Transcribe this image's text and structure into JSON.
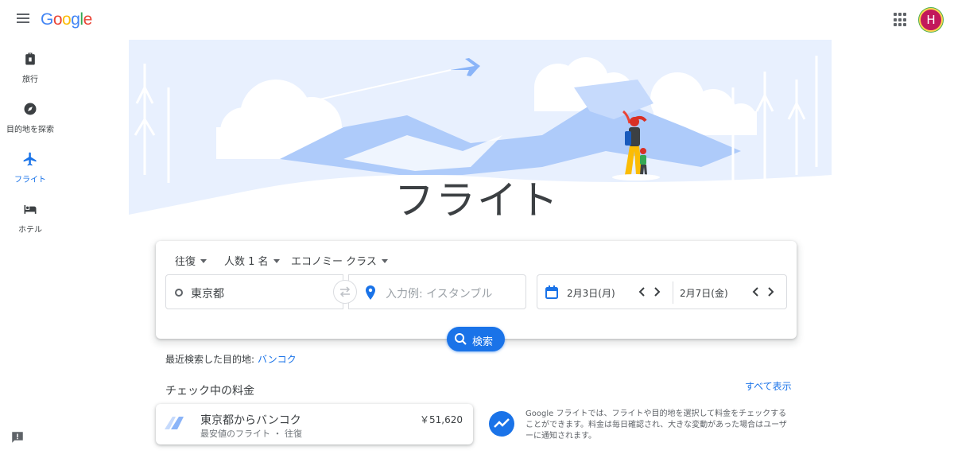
{
  "header": {
    "logo_letters": [
      {
        "ch": "G",
        "color": "#4285f4"
      },
      {
        "ch": "o",
        "color": "#ea4335"
      },
      {
        "ch": "o",
        "color": "#fbbc05"
      },
      {
        "ch": "g",
        "color": "#4285f4"
      },
      {
        "ch": "l",
        "color": "#34a853"
      },
      {
        "ch": "e",
        "color": "#ea4335"
      }
    ],
    "avatar_initial": "H"
  },
  "sidebar": {
    "items": [
      {
        "label": "旅行",
        "icon": "luggage-icon",
        "active": false
      },
      {
        "label": "目的地を探索",
        "icon": "compass-icon",
        "active": false
      },
      {
        "label": "フライト",
        "icon": "airplane-icon",
        "active": true
      },
      {
        "label": "ホテル",
        "icon": "bed-icon",
        "active": false
      }
    ]
  },
  "hero": {
    "title": "フライト"
  },
  "search": {
    "trip_type": "往復",
    "passengers": "人数 1 名",
    "cabin_class": "エコノミー クラス",
    "origin": "東京都",
    "destination_placeholder": "入力例: イスタンブル",
    "depart_date": "2月3日(月)",
    "return_date": "2月7日(金)",
    "search_label": "検索"
  },
  "recent": {
    "label": "最近検索した目的地:",
    "destination": "バンコク"
  },
  "tracked": {
    "title": "チェック中の料金",
    "see_all": "すべて表示",
    "items": [
      {
        "route": "東京都からバンコク",
        "detail": "最安値のフライト ・ 往復",
        "price": "￥51,620"
      }
    ],
    "info": "Google フライトでは、フライトや目的地を選択して料金をチェックすることができます。料金は毎日確認され、大きな変動があった場合はユーザーに通知されます。"
  },
  "colors": {
    "accent": "#1a73e8",
    "avatar_bg": "#c2185b",
    "text": "#3c4043"
  }
}
